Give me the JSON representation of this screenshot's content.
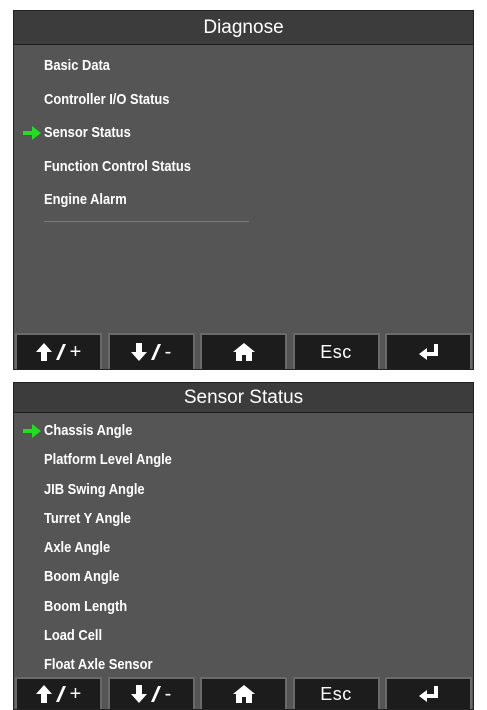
{
  "diagnose": {
    "title": "Diagnose",
    "selected_index": 2,
    "items": [
      {
        "label": "Basic Data"
      },
      {
        "label": "Controller I/O Status"
      },
      {
        "label": "Sensor Status"
      },
      {
        "label": "Function Control Status"
      },
      {
        "label": "Engine Alarm"
      }
    ]
  },
  "sensor_status": {
    "title": "Sensor Status",
    "selected_index": 0,
    "items": [
      {
        "label": "Chassis Angle"
      },
      {
        "label": "Platform Level Angle"
      },
      {
        "label": "JIB Swing Angle"
      },
      {
        "label": "Turret Y Angle"
      },
      {
        "label": "Axle Angle"
      },
      {
        "label": "Boom Angle"
      },
      {
        "label": "Boom Length"
      },
      {
        "label": "Load Cell"
      },
      {
        "label": "Float Axle Sensor"
      }
    ]
  },
  "buttons": {
    "up": {
      "icon": "up-arrow-icon",
      "symbol": "+"
    },
    "down": {
      "icon": "down-arrow-icon",
      "symbol": "-"
    },
    "home": {
      "icon": "home-icon"
    },
    "esc": {
      "label": "Esc"
    },
    "enter": {
      "icon": "enter-icon"
    }
  },
  "colors": {
    "screen_bg": "#555555",
    "title_bg": "#3c3c3c",
    "button_bg": "#1c1c1c",
    "selection_arrow": "#22dd22",
    "text": "#ffffff"
  }
}
